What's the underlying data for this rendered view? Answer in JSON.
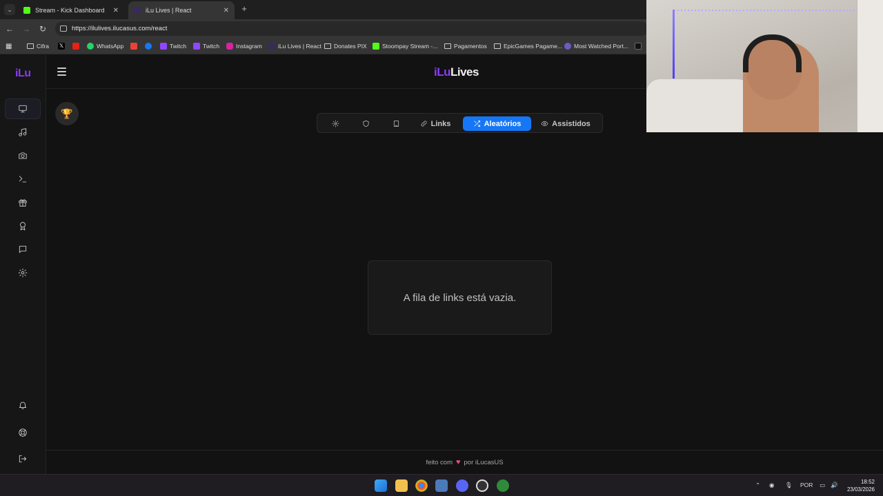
{
  "browser": {
    "tabs": [
      {
        "label": "Stream - Kick Dashboard",
        "favicon_color": "#53fc18"
      },
      {
        "label": "iLu Lives | React",
        "favicon_color": "#3a2a5a"
      }
    ],
    "url": "https://ilulives.ilucasus.com/react",
    "bookmarks": [
      {
        "label": "Cifra",
        "icon": "folder-icon"
      },
      {
        "label": "",
        "icon": "x-icon"
      },
      {
        "label": "",
        "icon": "youtube-icon"
      },
      {
        "label": "WhatsApp",
        "icon": "whatsapp-icon"
      },
      {
        "label": "",
        "icon": "gmail-icon"
      },
      {
        "label": "",
        "icon": "facebook-icon"
      },
      {
        "label": "Twitch",
        "icon": "twitch-icon"
      },
      {
        "label": "Twitch",
        "icon": "twitch-icon"
      },
      {
        "label": "Instagram",
        "icon": "instagram-icon"
      },
      {
        "label": "iLu Lives | React",
        "icon": "ilu-icon"
      },
      {
        "label": "Donates PIX",
        "icon": "folder-icon"
      },
      {
        "label": "Stoompay Stream -...",
        "icon": "kick-icon"
      },
      {
        "label": "Pagamentos",
        "icon": "folder-icon"
      },
      {
        "label": "EpicGames Pagame...",
        "icon": "folder-icon"
      },
      {
        "label": "Most Watched Port...",
        "icon": "globe-icon"
      }
    ]
  },
  "app": {
    "logo": "iLu",
    "brand_part1": "iLu",
    "brand_part2": "Lives",
    "sidebar_icons": [
      "monitor-icon",
      "music-icon",
      "camera-icon",
      "terminal-icon",
      "gift-icon",
      "award-icon",
      "message-icon",
      "settings-icon"
    ],
    "sidebar_bottom_icons": [
      "bell-icon",
      "lifebuoy-icon",
      "logout-icon"
    ],
    "tabs": [
      {
        "label": "",
        "icon": "gear-icon"
      },
      {
        "label": "",
        "icon": "shield-icon"
      },
      {
        "label": "",
        "icon": "tablet-icon"
      },
      {
        "label": "Links",
        "icon": "link-icon"
      },
      {
        "label": "Aleatórios",
        "icon": "shuffle-icon",
        "active": true
      },
      {
        "label": "Assistidos",
        "icon": "eye-icon"
      }
    ],
    "empty_message": "A fila de links está vazia.",
    "footer_prefix": "feito com",
    "footer_suffix": "por iLucasUS"
  },
  "taskbar": {
    "language": "POR",
    "time": "18:52",
    "date": "23/03/2026"
  },
  "colors": {
    "accent": "#1577f6",
    "brand_purple": "#8b3cf6"
  }
}
